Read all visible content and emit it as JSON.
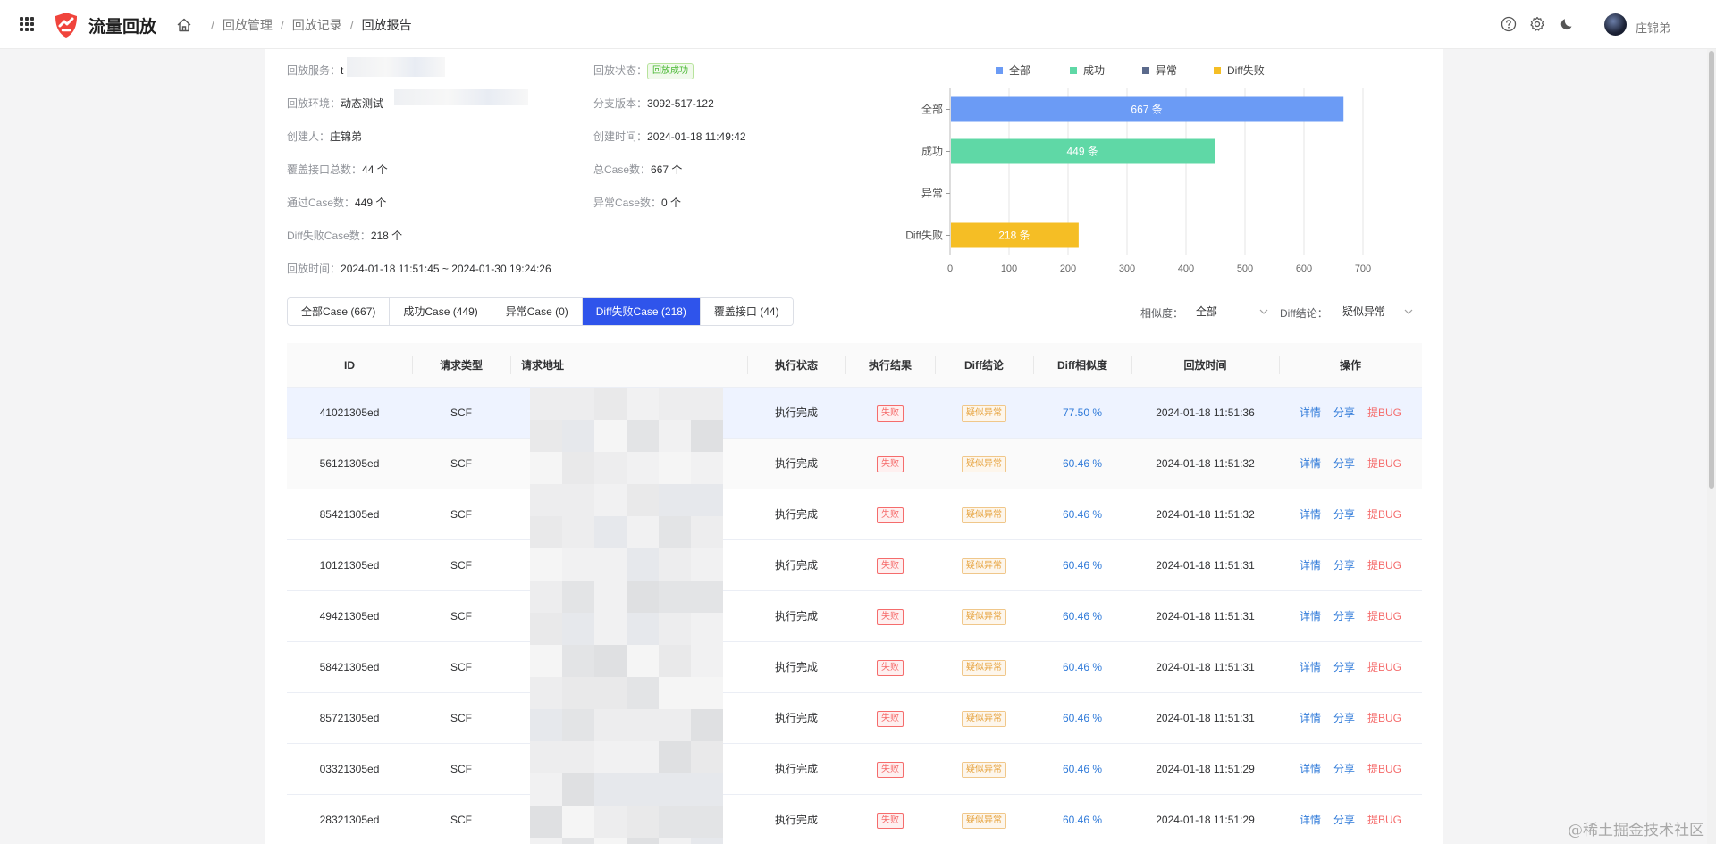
{
  "header": {
    "app_title": "流量回放",
    "breadcrumb": [
      "回放管理",
      "回放记录",
      "回放报告"
    ],
    "user_name": "庄锦弟",
    "icons": [
      "apps-grid-icon",
      "home-icon",
      "help-icon",
      "gear-icon",
      "moon-icon"
    ]
  },
  "info": {
    "service_label": "回放服务：",
    "service_value": "t",
    "status_label": "回放状态：",
    "status_value": "回放成功",
    "env_label": "回放环境：",
    "env_value": "动态测试",
    "branch_label": "分支版本：",
    "branch_value": "3092-517-122",
    "creator_label": "创建人：",
    "creator_value": "庄锦弟",
    "created_label": "创建时间：",
    "created_value": "2024-01-18 11:49:42",
    "iface_label": "覆盖接口总数：",
    "iface_value": "44 个",
    "total_label": "总Case数：",
    "total_value": "667 个",
    "passed_label": "通过Case数：",
    "passed_value": "449 个",
    "error_label": "异常Case数：",
    "error_value": "0 个",
    "diff_label": "Diff失败Case数：",
    "diff_value": "218 个",
    "time_label": "回放时间：",
    "time_value": "2024-01-18 11:51:45 ~ 2024-01-30 19:24:26"
  },
  "chart_data": {
    "type": "bar",
    "orientation": "horizontal",
    "categories": [
      "全部",
      "成功",
      "异常",
      "Diff失败"
    ],
    "values": [
      667,
      449,
      0,
      218
    ],
    "data_labels": [
      "667 条",
      "449 条",
      "",
      "218 条"
    ],
    "legend": [
      "全部",
      "成功",
      "异常",
      "Diff失败"
    ],
    "legend_position": "top",
    "colors": [
      "#6b9bf5",
      "#5fd8a6",
      "#5b6a8c",
      "#f5be25"
    ],
    "xlim": [
      0,
      700
    ],
    "xticks": [
      0,
      100,
      200,
      300,
      400,
      500,
      600,
      700
    ],
    "grid": true
  },
  "tabs": [
    {
      "label": "全部Case (667)",
      "active": false
    },
    {
      "label": "成功Case (449)",
      "active": false
    },
    {
      "label": "异常Case (0)",
      "active": false
    },
    {
      "label": "Diff失败Case (218)",
      "active": true
    },
    {
      "label": "覆盖接口 (44)",
      "active": false
    }
  ],
  "filters": {
    "similarity_label": "相似度：",
    "similarity_value": "全部",
    "conclusion_label": "Diff结论：",
    "conclusion_value": "疑似异常"
  },
  "table": {
    "columns": [
      "ID",
      "请求类型",
      "请求地址",
      "执行状态",
      "执行结果",
      "Diff结论",
      "Diff相似度",
      "回放时间",
      "操作"
    ],
    "actions": [
      "详情",
      "分享",
      "提BUG"
    ],
    "rows": [
      {
        "id": "41021305ed",
        "type": "SCF",
        "status": "执行完成",
        "result": "失败",
        "conclusion": "疑似异常",
        "similarity": "77.50 %",
        "time": "2024-01-18 11:51:36"
      },
      {
        "id": "56121305ed",
        "type": "SCF",
        "status": "执行完成",
        "result": "失败",
        "conclusion": "疑似异常",
        "similarity": "60.46 %",
        "time": "2024-01-18 11:51:32"
      },
      {
        "id": "85421305ed",
        "type": "SCF",
        "status": "执行完成",
        "result": "失败",
        "conclusion": "疑似异常",
        "similarity": "60.46 %",
        "time": "2024-01-18 11:51:32"
      },
      {
        "id": "10121305ed",
        "type": "SCF",
        "status": "执行完成",
        "result": "失败",
        "conclusion": "疑似异常",
        "similarity": "60.46 %",
        "time": "2024-01-18 11:51:31"
      },
      {
        "id": "49421305ed",
        "type": "SCF",
        "status": "执行完成",
        "result": "失败",
        "conclusion": "疑似异常",
        "similarity": "60.46 %",
        "time": "2024-01-18 11:51:31"
      },
      {
        "id": "58421305ed",
        "type": "SCF",
        "status": "执行完成",
        "result": "失败",
        "conclusion": "疑似异常",
        "similarity": "60.46 %",
        "time": "2024-01-18 11:51:31"
      },
      {
        "id": "85721305ed",
        "type": "SCF",
        "status": "执行完成",
        "result": "失败",
        "conclusion": "疑似异常",
        "similarity": "60.46 %",
        "time": "2024-01-18 11:51:31"
      },
      {
        "id": "03321305ed",
        "type": "SCF",
        "status": "执行完成",
        "result": "失败",
        "conclusion": "疑似异常",
        "similarity": "60.46 %",
        "time": "2024-01-18 11:51:29"
      },
      {
        "id": "28321305ed",
        "type": "SCF",
        "status": "执行完成",
        "result": "失败",
        "conclusion": "疑似异常",
        "similarity": "60.46 %",
        "time": "2024-01-18 11:51:29"
      }
    ]
  },
  "watermark": "@稀土掘金技术社区"
}
